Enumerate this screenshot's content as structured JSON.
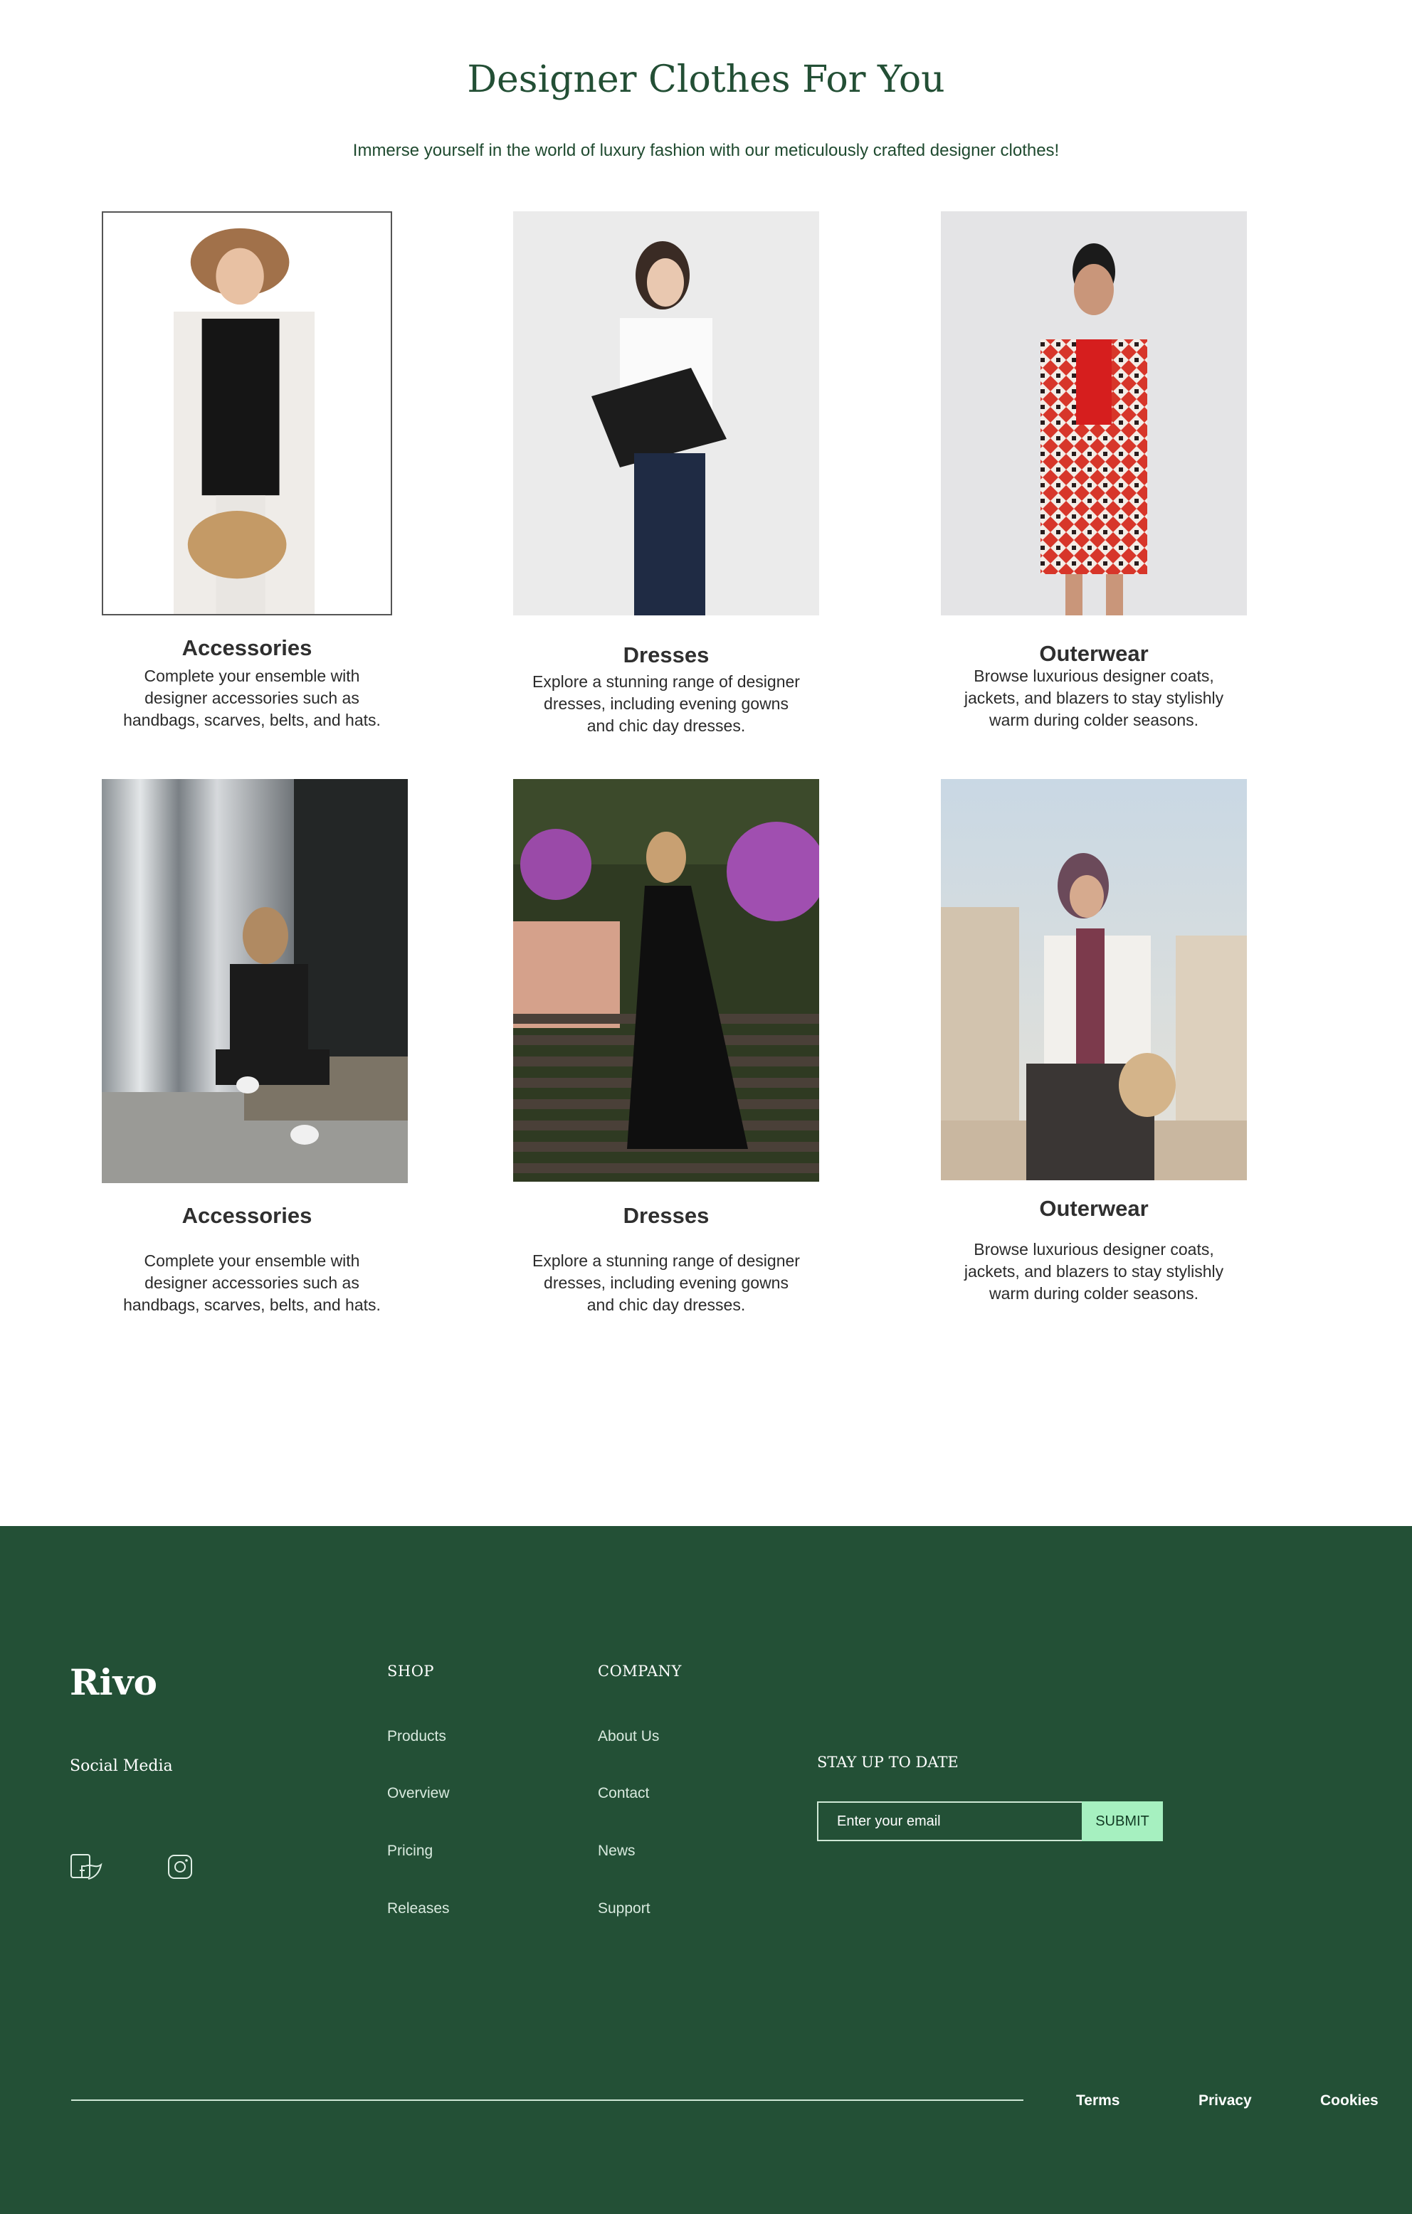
{
  "hero": {
    "title": "Designer Clothes For You",
    "subtitle": "Immerse yourself in the world of luxury fashion with our meticulously crafted designer clothes!"
  },
  "cards": [
    {
      "title": "Accessories",
      "desc": [
        "Complete your ensemble with",
        "designer accessories such as",
        "handbags, scarves, belts, and hats."
      ]
    },
    {
      "title": "Dresses",
      "desc": [
        "Explore a stunning range of designer",
        "dresses, including evening gowns",
        "and chic day dresses."
      ]
    },
    {
      "title": "Outerwear",
      "desc": [
        "Browse luxurious designer coats,",
        "jackets, and blazers to stay stylishly",
        "warm during colder seasons."
      ]
    },
    {
      "title": "Accessories",
      "desc": [
        "Complete your ensemble with",
        "designer accessories such as",
        "handbags, scarves, belts, and hats."
      ]
    },
    {
      "title": "Dresses",
      "desc": [
        "Explore a stunning range of designer",
        "dresses, including evening gowns",
        "and chic day dresses."
      ]
    },
    {
      "title": "Outerwear",
      "desc": [
        "Browse luxurious designer coats,",
        "jackets, and blazers to stay stylishly",
        "warm during colder seasons."
      ]
    }
  ],
  "footer": {
    "brand": "Rivo",
    "social_label": "Social Media",
    "social_icons": [
      "facebook-twitter-icon",
      "instagram-icon"
    ],
    "shop": {
      "heading": "SHOP",
      "links": [
        "Products",
        "Overview",
        "Pricing",
        "Releases"
      ]
    },
    "company": {
      "heading": "COMPANY",
      "links": [
        "About Us",
        "Contact",
        "News",
        "Support"
      ]
    },
    "newsletter": {
      "heading": "STAY UP TO DATE",
      "placeholder": "Enter your email",
      "button": "SUBMIT"
    },
    "legal": [
      "Terms",
      "Privacy",
      "Cookies"
    ]
  },
  "colors": {
    "brand_green": "#235036",
    "title_green": "#234f35",
    "button_mint": "#a6f0c0"
  }
}
